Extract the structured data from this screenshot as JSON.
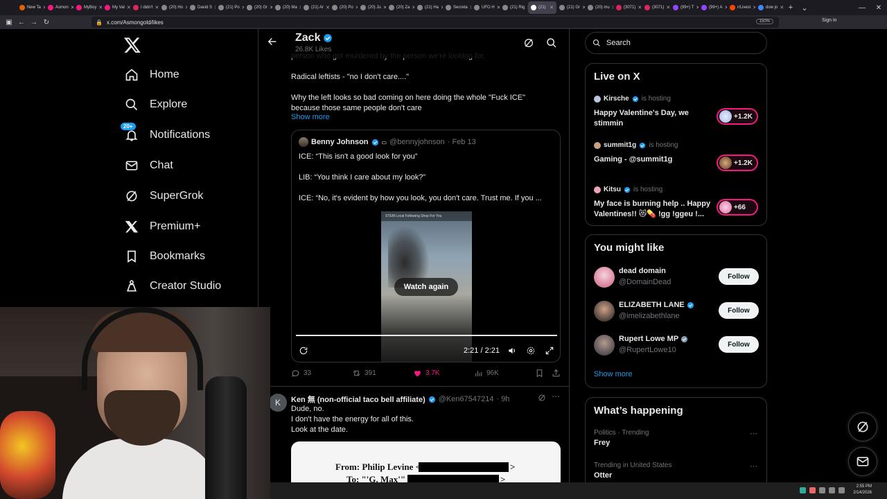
{
  "browser": {
    "tabs": [
      {
        "label": "New Ta",
        "color": "#e66000"
      },
      {
        "label": "Asmon",
        "color": "#f91880"
      },
      {
        "label": "MyBoy",
        "color": "#f91880"
      },
      {
        "label": "My Val",
        "color": "#f91880"
      },
      {
        "label": "I didn't",
        "color": "#e0245e"
      },
      {
        "label": "(20) Ho",
        "color": "#888888"
      },
      {
        "label": "David S",
        "color": "#888888"
      },
      {
        "label": "(21) Po",
        "color": "#888888"
      },
      {
        "label": "(20) Gr",
        "color": "#888888"
      },
      {
        "label": "(20) Ma",
        "color": "#888888"
      },
      {
        "label": "(21) Ar",
        "color": "#888888"
      },
      {
        "label": "(20) Po",
        "color": "#888888"
      },
      {
        "label": "(20) Ju",
        "color": "#888888"
      },
      {
        "label": "(20) Za",
        "color": "#888888"
      },
      {
        "label": "(21) Ha",
        "color": "#888888"
      },
      {
        "label": "Secreta",
        "color": "#888888"
      },
      {
        "label": "UFO H",
        "color": "#888888"
      },
      {
        "label": "(21) Rig",
        "color": "#888888"
      },
      {
        "label": "(21)",
        "color": "#ffffff",
        "active": true
      },
      {
        "label": "(21) Gr",
        "color": "#888888"
      },
      {
        "label": "(20) mu",
        "color": "#888888"
      },
      {
        "label": "(3071)",
        "color": "#e0245e"
      },
      {
        "label": "(3071)",
        "color": "#e0245e"
      },
      {
        "label": "(99+) T",
        "color": "#9146ff"
      },
      {
        "label": "(99+) A",
        "color": "#9146ff"
      },
      {
        "label": "r/Livest",
        "color": "#ff4500"
      },
      {
        "label": "dow jo",
        "color": "#4285f4"
      }
    ],
    "url": "x.com/Asmongold/likes",
    "zoom": "150%",
    "signin": "Sign in"
  },
  "nav": {
    "items": [
      {
        "label": "Home",
        "icon": "home-icon"
      },
      {
        "label": "Explore",
        "icon": "search-icon"
      },
      {
        "label": "Notifications",
        "icon": "bell-icon",
        "badge": "20+"
      },
      {
        "label": "Chat",
        "icon": "mail-icon"
      },
      {
        "label": "SuperGrok",
        "icon": "grok-icon"
      },
      {
        "label": "Premium+",
        "icon": "x-icon"
      },
      {
        "label": "Bookmarks",
        "icon": "bookmark-icon"
      },
      {
        "label": "Creator Studio",
        "icon": "flask-icon"
      }
    ]
  },
  "header": {
    "name": "Zack",
    "likes": "26.8K Likes"
  },
  "post": {
    "cut_line": "person who got murdered by the person we're looking for.",
    "line1": "Radical leftists - \"no I don't care....\"",
    "line2": "Why the left looks so bad coming on here doing the whole \"Fuck ICE\"",
    "line3": "because those same people don't care",
    "show_more": "Show more",
    "quote": {
      "name": "Benny Johnson",
      "handle": "@bennyjohnson",
      "date": "· Feb 13",
      "line1": "ICE: “This isn't a good look for you”",
      "line2": "LIB: “You think I care about my look?”",
      "line3": "ICE: “No, it's evident by how you look, you don't care. Trust me. If you ...",
      "video_header": "STEM  Local  Following  Shop  For You",
      "watch_again": "Watch again",
      "time": "2:21 / 2:21",
      "progress": 1.0
    },
    "stats": {
      "replies": "33",
      "reposts": "391",
      "likes": "3.7K",
      "views": "96K"
    }
  },
  "reply": {
    "avatar_letter": "K",
    "name": "Ken 無 (non-official taco bell affiliate)",
    "handle": "@Ken67547214",
    "time": "· 9h",
    "line1": "Dude, no.",
    "line2": "I don't have the energy for all of this.",
    "line3": "Look at the date.",
    "doc_from": "From: Philip Levine <",
    "doc_to": "To: \"'G. Max'\" <",
    "doc_close": ">"
  },
  "sidebar": {
    "search_placeholder": "Search",
    "live": {
      "title": "Live on X",
      "hosting_label": "is hosting",
      "items": [
        {
          "host": "Kirsche",
          "title": "Happy Valentine's Day, we stimmin",
          "count": "+1.2K"
        },
        {
          "host": "summit1g",
          "title": "Gaming - @summit1g",
          "count": "+1.2K"
        },
        {
          "host": "Kitsu",
          "title": "My face is burning help .. Happy Valentines!! 😻💊 !gg !ggeu !...",
          "count": "+66"
        }
      ]
    },
    "suggestions": {
      "title": "You might like",
      "follow_label": "Follow",
      "items": [
        {
          "name": "dead domain",
          "handle": "@DomainDead",
          "verified": false
        },
        {
          "name": "ELIZABETH LANE",
          "handle": "@imelizabethlane",
          "verified": true
        },
        {
          "name": "Rupert Lowe MP",
          "handle": "@RupertLowe10",
          "verified": true
        }
      ],
      "show_more": "Show more"
    },
    "happening": {
      "title": "What’s happening",
      "items": [
        {
          "context": "Politics · Trending",
          "name": "Frey"
        },
        {
          "context": "Trending in United States",
          "name": "Otter"
        }
      ]
    }
  },
  "taskbar": {
    "time": "2:55 PM",
    "date": "2/14/2026"
  },
  "colors": {
    "accent": "#1d9bf0",
    "like": "#f91880",
    "live": "#f91880"
  }
}
